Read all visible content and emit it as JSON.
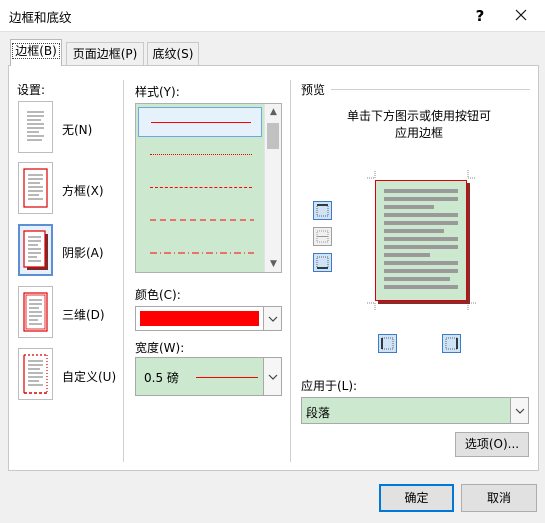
{
  "window": {
    "title": "边框和底纹",
    "help": "?"
  },
  "tabs": [
    {
      "label": "边框(B)",
      "active": true
    },
    {
      "label": "页面边框(P)",
      "active": false
    },
    {
      "label": "底纹(S)",
      "active": false
    }
  ],
  "setting": {
    "label": "设置:",
    "options": [
      {
        "label": "无(N)",
        "selected": false
      },
      {
        "label": "方框(X)",
        "selected": false
      },
      {
        "label": "阴影(A)",
        "selected": true
      },
      {
        "label": "三维(D)",
        "selected": false
      },
      {
        "label": "自定义(U)",
        "selected": false
      }
    ]
  },
  "style": {
    "label": "样式(Y):",
    "items": [
      "solid",
      "dotted",
      "dashed-small",
      "dashed-large",
      "dash-dot"
    ],
    "selected_index": 0
  },
  "color": {
    "label": "颜色(C):",
    "value": "#ff0000"
  },
  "width": {
    "label": "宽度(W):",
    "value": "0.5 磅"
  },
  "preview": {
    "label": "预览",
    "hint": "单击下方图示或使用按钮可\n应用边框"
  },
  "apply_to": {
    "label": "应用于(L):",
    "value": "段落"
  },
  "buttons": {
    "options": "选项(O)...",
    "ok": "确定",
    "cancel": "取消"
  },
  "colors": {
    "accent_green": "#cce8cf",
    "border_red": "#ff0000",
    "focus_blue": "#0078d7"
  }
}
